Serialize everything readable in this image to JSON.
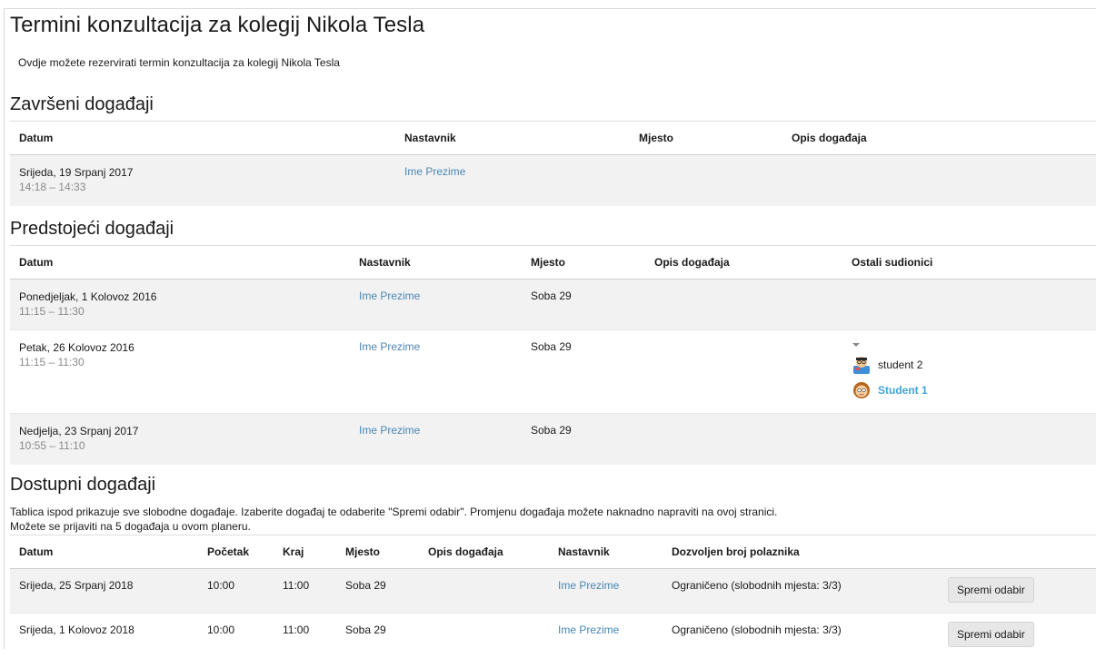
{
  "page": {
    "title": "Termini konzultacija za kolegij Nikola Tesla",
    "intro": "Ovdje možete rezervirati termin konzultacija za kolegij Nikola Tesla"
  },
  "completed": {
    "title": "Završeni događaji",
    "headers": {
      "date": "Datum",
      "teacher": "Nastavnik",
      "place": "Mjesto",
      "desc": "Opis događaja"
    },
    "rows": [
      {
        "date": "Srijeda, 19 Srpanj 2017",
        "time": "14:18 – 14:33",
        "teacher": "Ime Prezime",
        "place": "",
        "desc": ""
      }
    ]
  },
  "upcoming": {
    "title": "Predstojeći događaji",
    "headers": {
      "date": "Datum",
      "teacher": "Nastavnik",
      "place": "Mjesto",
      "desc": "Opis događaja",
      "others": "Ostali sudionici"
    },
    "rows": [
      {
        "date": "Ponedjeljak, 1 Kolovoz 2016",
        "time": "11:15 – 11:30",
        "teacher": "Ime Prezime",
        "place": "Soba 29",
        "desc": ""
      },
      {
        "date": "Petak, 26 Kolovoz 2016",
        "time": "11:15 – 11:30",
        "teacher": "Ime Prezime",
        "place": "Soba 29",
        "desc": "",
        "participants": [
          {
            "name": "student 2",
            "avatar": "avatar-icon"
          },
          {
            "name": "Student 1",
            "avatar": "avatar-icon"
          }
        ]
      },
      {
        "date": "Nedjelja, 23 Srpanj 2017",
        "time": "10:55 – 11:10",
        "teacher": "Ime Prezime",
        "place": "Soba 29",
        "desc": ""
      }
    ]
  },
  "available": {
    "title": "Dostupni događaji",
    "desc1": "Tablica ispod prikazuje sve slobodne događaje. Izaberite događaj te odaberite \"Spremi odabir\". Promjenu događaja možete naknadno napraviti na ovoj stranici.",
    "desc2": "Možete se prijaviti na 5 događaja u ovom planeru.",
    "headers": {
      "date": "Datum",
      "start": "Početak",
      "end": "Kraj",
      "place": "Mjesto",
      "desc": "Opis događaja",
      "teacher": "Nastavnik",
      "limit": "Dozvoljen broj polaznika"
    },
    "rows": [
      {
        "date": "Srijeda, 25 Srpanj 2018",
        "start": "10:00",
        "end": "11:00",
        "place": "Soba 29",
        "desc": "",
        "teacher": "Ime Prezime",
        "limit": "Ograničeno (slobodnih mjesta: 3/3)",
        "button": "Spremi odabir"
      },
      {
        "date": "Srijeda, 1 Kolovoz 2018",
        "start": "10:00",
        "end": "11:00",
        "place": "Soba 29",
        "desc": "",
        "teacher": "Ime Prezime",
        "limit": "Ograničeno (slobodnih mjesta: 3/3)",
        "button": "Spremi odabir"
      }
    ]
  },
  "colors": {
    "link": "#4a86b3",
    "student_link": "#3ea6d9",
    "row_shade": "#f2f2f2"
  }
}
